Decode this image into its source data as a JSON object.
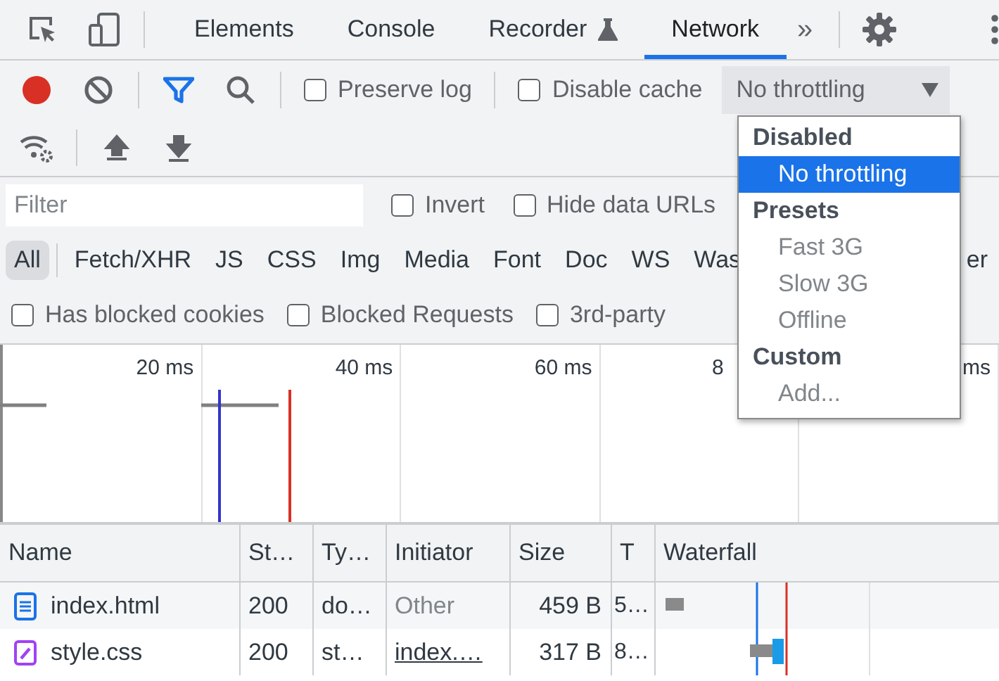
{
  "main_tabs": [
    {
      "label": "Elements",
      "selected": false,
      "kind": "plain"
    },
    {
      "label": "Console",
      "selected": false,
      "kind": "plain"
    },
    {
      "label": "Recorder",
      "selected": false,
      "kind": "experiment"
    },
    {
      "label": "Network",
      "selected": true,
      "kind": "plain"
    }
  ],
  "more_tabs": "»",
  "network_toolbar": {
    "recording": true,
    "options": [
      {
        "label": "Preserve log",
        "checked": false
      },
      {
        "label": "Disable cache",
        "checked": false
      }
    ],
    "throttling": "No throttling"
  },
  "filter_bar": {
    "placeholder": "Filter",
    "options": [
      {
        "label": "Invert",
        "checked": false
      },
      {
        "label": "Hide data URLs",
        "checked": false
      }
    ]
  },
  "type_filters": [
    {
      "label": "All",
      "selected": true
    },
    {
      "label": "Fetch/XHR",
      "selected": false
    },
    {
      "label": "JS",
      "selected": false
    },
    {
      "label": "CSS",
      "selected": false
    },
    {
      "label": "Img",
      "selected": false
    },
    {
      "label": "Media",
      "selected": false
    },
    {
      "label": "Font",
      "selected": false
    },
    {
      "label": "Doc",
      "selected": false
    },
    {
      "label": "WS",
      "selected": false
    },
    {
      "label": "Was",
      "selected": false
    },
    {
      "label": "er",
      "selected": false
    }
  ],
  "blocked_filters": [
    {
      "label": "Has blocked cookies",
      "checked": false
    },
    {
      "label": "Blocked Requests",
      "checked": false
    },
    {
      "label": "3rd-party",
      "checked": false
    }
  ],
  "overview": {
    "ticks": [
      "20 ms",
      "40 ms",
      "60 ms",
      "8",
      "ms"
    ]
  },
  "table": {
    "columns": [
      "Name",
      "St…",
      "Ty…",
      "Initiator",
      "Size",
      "T",
      "Waterfall"
    ],
    "rows": [
      {
        "kind": "document",
        "name": "index.html",
        "status": "200",
        "type": "do…",
        "initiator": "Other",
        "initiator_link": false,
        "size": "459 B",
        "time": "5…"
      },
      {
        "kind": "stylesheet",
        "name": "style.css",
        "status": "200",
        "type": "st…",
        "initiator": "index.…",
        "initiator_link": true,
        "size": "317 B",
        "time": "8…"
      }
    ]
  },
  "throttle_menu": {
    "groups": [
      {
        "heading": "Disabled",
        "items": [
          {
            "label": "No throttling",
            "selected": true
          }
        ]
      },
      {
        "heading": "Presets",
        "items": [
          {
            "label": "Fast 3G",
            "selected": false
          },
          {
            "label": "Slow 3G",
            "selected": false
          },
          {
            "label": "Offline",
            "selected": false
          }
        ]
      },
      {
        "heading": "Custom",
        "items": [
          {
            "label": "Add...",
            "selected": false
          }
        ]
      }
    ]
  }
}
